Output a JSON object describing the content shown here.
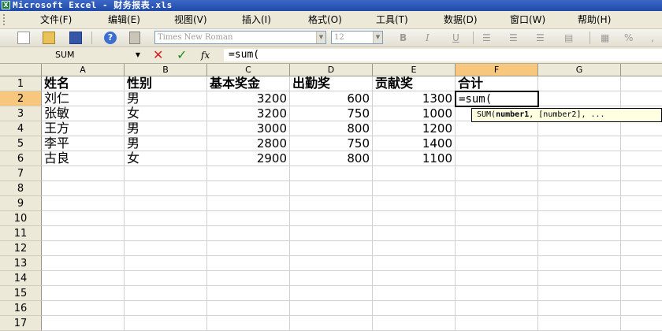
{
  "window": {
    "title": "Microsoft Excel - 财务报表.xls"
  },
  "menu": [
    "文件(F)",
    "编辑(E)",
    "视图(V)",
    "插入(I)",
    "格式(O)",
    "工具(T)",
    "数据(D)",
    "窗口(W)",
    "帮助(H)"
  ],
  "toolbar": {
    "font_name": "Times New Roman",
    "font_size": "12",
    "bold": "B",
    "italic": "I",
    "underline": "U",
    "percent": "%"
  },
  "formula_bar": {
    "name_box": "SUM",
    "cancel_symbol": "✕",
    "enter_symbol": "✓",
    "fx_label": "fx",
    "content": "=sum("
  },
  "sheet": {
    "columns": [
      "A",
      "B",
      "C",
      "D",
      "E",
      "F",
      "G"
    ],
    "rows": [
      "1",
      "2",
      "3",
      "4",
      "5",
      "6",
      "7",
      "8",
      "9",
      "10",
      "11",
      "12",
      "13",
      "14",
      "15",
      "16",
      "17"
    ],
    "header": [
      "姓名",
      "性别",
      "基本奖金",
      "出勤奖",
      "贡献奖",
      "合计"
    ],
    "data": [
      [
        "刘仁",
        "男",
        "3200",
        "600",
        "1300"
      ],
      [
        "张敏",
        "女",
        "3200",
        "750",
        "1000"
      ],
      [
        "王方",
        "男",
        "3000",
        "800",
        "1200"
      ],
      [
        "李平",
        "男",
        "2800",
        "750",
        "1400"
      ],
      [
        "古良",
        "女",
        "2900",
        "800",
        "1100"
      ]
    ],
    "active_cell_value": "=sum(",
    "active_column": "F",
    "active_row": "2"
  },
  "tooltip": {
    "func": "SUM(",
    "arg1": "number1",
    "rest": ", [number2], ..."
  }
}
